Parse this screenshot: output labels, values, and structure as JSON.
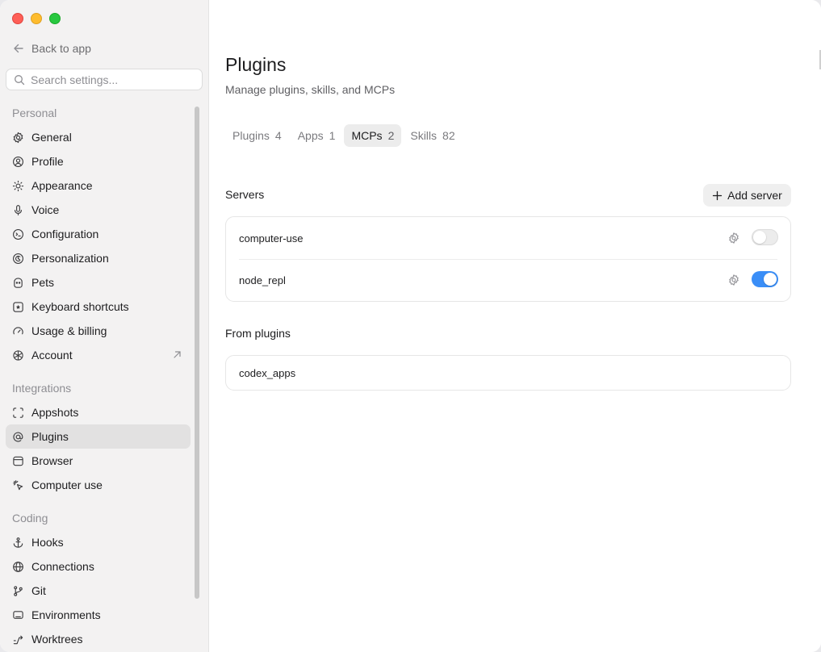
{
  "window": {
    "traffic_lights": [
      "close",
      "minimize",
      "maximize"
    ]
  },
  "sidebar": {
    "back_label": "Back to app",
    "search_placeholder": "Search settings...",
    "sections": [
      {
        "title": "Personal",
        "items": [
          {
            "label": "General",
            "icon": "gear-icon"
          },
          {
            "label": "Profile",
            "icon": "profile-icon"
          },
          {
            "label": "Appearance",
            "icon": "sun-icon"
          },
          {
            "label": "Voice",
            "icon": "microphone-icon"
          },
          {
            "label": "Configuration",
            "icon": "configuration-icon"
          },
          {
            "label": "Personalization",
            "icon": "personalization-icon"
          },
          {
            "label": "Pets",
            "icon": "pets-icon"
          },
          {
            "label": "Keyboard shortcuts",
            "icon": "keyboard-icon"
          },
          {
            "label": "Usage & billing",
            "icon": "gauge-icon"
          },
          {
            "label": "Account",
            "icon": "openai-icon",
            "external": true
          }
        ]
      },
      {
        "title": "Integrations",
        "items": [
          {
            "label": "Appshots",
            "icon": "appshots-icon"
          },
          {
            "label": "Plugins",
            "icon": "at-sign-icon",
            "active": true
          },
          {
            "label": "Browser",
            "icon": "browser-icon"
          },
          {
            "label": "Computer use",
            "icon": "cursor-icon"
          }
        ]
      },
      {
        "title": "Coding",
        "items": [
          {
            "label": "Hooks",
            "icon": "anchor-icon"
          },
          {
            "label": "Connections",
            "icon": "globe-icon"
          },
          {
            "label": "Git",
            "icon": "git-branch-icon"
          },
          {
            "label": "Environments",
            "icon": "laptop-icon"
          },
          {
            "label": "Worktrees",
            "icon": "worktree-icon"
          }
        ]
      }
    ]
  },
  "main": {
    "title": "Plugins",
    "subtitle": "Manage plugins, skills, and MCPs",
    "tabs": [
      {
        "label": "Plugins",
        "count": "4"
      },
      {
        "label": "Apps",
        "count": "1"
      },
      {
        "label": "MCPs",
        "count": "2",
        "active": true
      },
      {
        "label": "Skills",
        "count": "82"
      }
    ],
    "servers_heading": "Servers",
    "add_server_label": "Add server",
    "servers": [
      {
        "name": "computer-use",
        "enabled": false
      },
      {
        "name": "node_repl",
        "enabled": true
      }
    ],
    "from_plugins_heading": "From plugins",
    "plugin_servers": [
      {
        "name": "codex_apps"
      }
    ]
  },
  "colors": {
    "accent": "#3a8ef7",
    "sidebar_bg": "#f3f2f2",
    "active_item_bg": "#e2e1e1",
    "close": "#fe5f57",
    "minimize": "#febc2e",
    "maximize": "#28c840"
  }
}
